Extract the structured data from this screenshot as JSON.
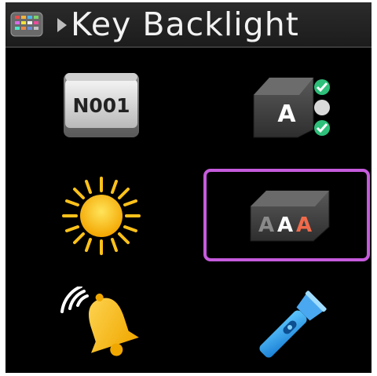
{
  "header": {
    "title": "Key Backlight",
    "app_icon": "keyboard-grid-icon",
    "separator_icon": "chevron-right-icon"
  },
  "grid": {
    "items": [
      {
        "id": "number",
        "icon": "n001-key-icon",
        "label": "N001"
      },
      {
        "id": "key-status",
        "icon": "key-a-status-icon",
        "label": "A"
      },
      {
        "id": "brightness",
        "icon": "sun-icon"
      },
      {
        "id": "text-size",
        "icon": "aaa-text-icon",
        "label_parts": [
          "A",
          "A",
          "A"
        ],
        "selected": true
      },
      {
        "id": "notification",
        "icon": "bell-ringing-icon"
      },
      {
        "id": "flashlight",
        "icon": "flashlight-icon"
      }
    ]
  },
  "colors": {
    "selection_border": "#c65bdc",
    "background": "#000000",
    "check_green": "#2ebf7a",
    "sun_yellow": "#ffbf1a"
  }
}
